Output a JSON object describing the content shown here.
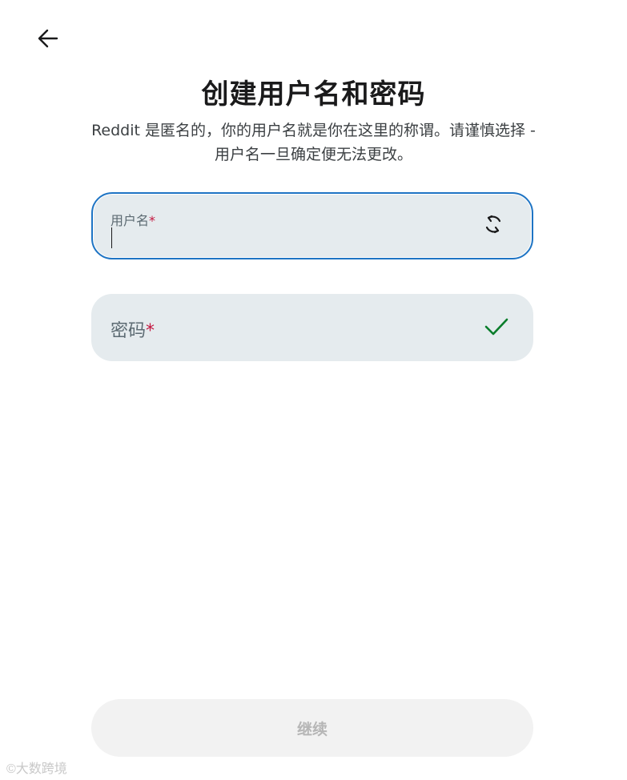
{
  "header": {
    "title": "创建用户名和密码",
    "subtitle": "Reddit 是匿名的，你的用户名就是你在这里的称谓。请谨慎选择 - 用户名一旦确定便无法更改。"
  },
  "form": {
    "username": {
      "label": "用户名",
      "required_mark": "*",
      "value": "",
      "icon": "refresh-icon"
    },
    "password": {
      "label": "密码",
      "required_mark": "*",
      "value": "",
      "icon": "checkmark-icon",
      "icon_color": "#0a7d2b"
    }
  },
  "actions": {
    "continue_label": "继续"
  },
  "watermark": {
    "text": "©大数跨境"
  },
  "colors": {
    "focus_border": "#1e74c4",
    "field_bg": "#e5ebee",
    "required": "#c4163f",
    "disabled_button_bg": "#f2f2f2",
    "disabled_button_text": "#b6b6b6"
  }
}
